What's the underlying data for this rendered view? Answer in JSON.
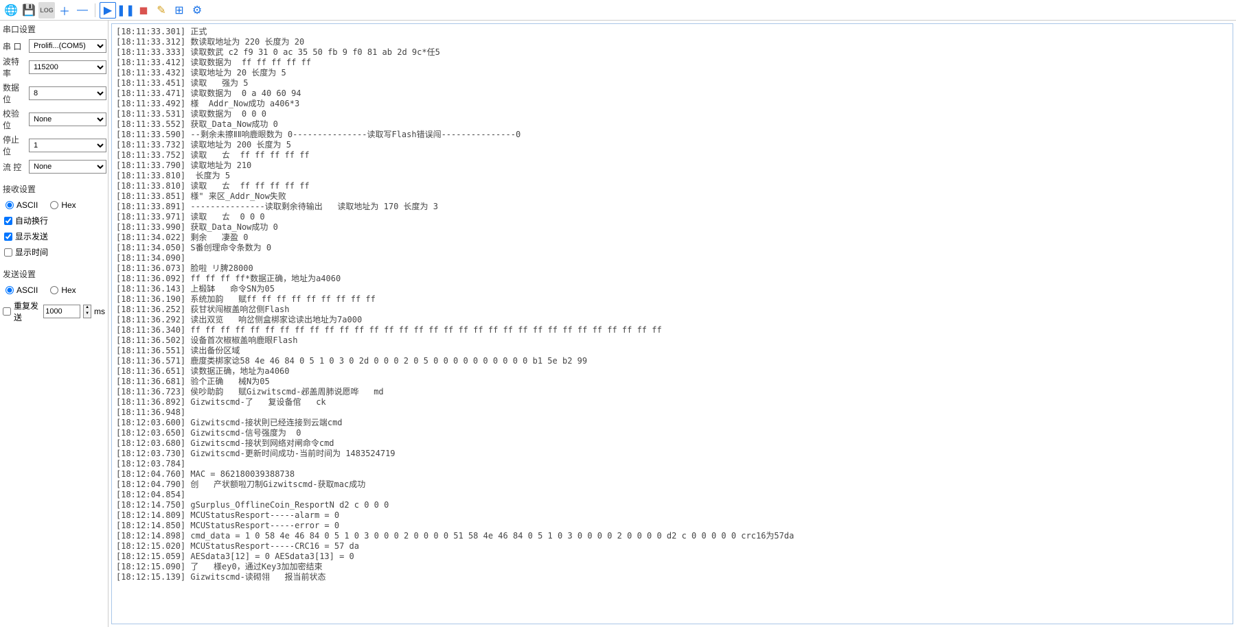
{
  "toolbar": {
    "icons": [
      {
        "name": "globe-icon",
        "glyph": "🌐",
        "color": "#1a73e8"
      },
      {
        "name": "save-icon",
        "glyph": "💾",
        "color": "#4caf50"
      },
      {
        "name": "log-icon",
        "glyph": "LOG",
        "color": "#666",
        "small": true
      },
      {
        "name": "plus-icon",
        "glyph": "＋",
        "color": "#1a73e8"
      },
      {
        "name": "minus-icon",
        "glyph": "—",
        "color": "#1a73e8"
      },
      {
        "name": "sep"
      },
      {
        "name": "play-icon",
        "glyph": "▶",
        "color": "#1a73e8",
        "boxed": true
      },
      {
        "name": "pause-icon",
        "glyph": "❚❚",
        "color": "#1a73e8"
      },
      {
        "name": "stop-icon",
        "glyph": "◼",
        "color": "#d9534f"
      },
      {
        "name": "wand-icon",
        "glyph": "✎",
        "color": "#d4a020"
      },
      {
        "name": "add-panel-icon",
        "glyph": "⊞",
        "color": "#1a73e8"
      },
      {
        "name": "gear-icon",
        "glyph": "⚙",
        "color": "#1a73e8"
      }
    ]
  },
  "port_settings": {
    "header": "串口设置",
    "port": {
      "label": "串  口",
      "value": "Prolifi...(COM5)"
    },
    "baud": {
      "label": "波特率",
      "value": "115200"
    },
    "databits": {
      "label": "数据位",
      "value": "8"
    },
    "parity": {
      "label": "校验位",
      "value": "None"
    },
    "stopbits": {
      "label": "停止位",
      "value": "1"
    },
    "flow": {
      "label": "流  控",
      "value": "None"
    }
  },
  "recv_settings": {
    "header": "接收设置",
    "ascii": "ASCII",
    "hex": "Hex",
    "ascii_selected": true,
    "auto_wrap": {
      "label": "自动换行",
      "checked": true
    },
    "show_send": {
      "label": "显示发送",
      "checked": true
    },
    "show_time": {
      "label": "显示时间",
      "checked": false
    }
  },
  "send_settings": {
    "header": "发送设置",
    "ascii": "ASCII",
    "hex": "Hex",
    "ascii_selected": true,
    "repeat_send": {
      "label": "重复发送",
      "checked": false,
      "value": "1000",
      "unit": "ms"
    }
  },
  "log": [
    "[18:11:33.301] 正式",
    "[18:11:33.312] 数读取地址为 220 长度为 20",
    "[18:11:33.333] 读取数武 c2 f9 31 0 ac 35 50 fb 9 f0 81 ab 2d 9c*任5",
    "[18:11:33.412] 读取数据为  ff ff ff ff ff",
    "[18:11:33.432] 读取地址为 20 长度为 5",
    "[18:11:33.451] 读取   强为 5",
    "[18:11:33.471] 读取数据为  0 a 40 60 94",
    "[18:11:33.492] 様  Addr_Now成功 a406*3",
    "[18:11:33.531] 读取数据为  0 0 0",
    "[18:11:33.552] 获取_Data_Now成功 0",
    "[18:11:33.590] --剩余未擦ⅡⅡ响鹿眼数为 0---------------读取写Flash错误闯---------------0",
    "[18:11:33.732] 读取地址为 200 长度为 5",
    "[18:11:33.752] 读取   ㄊ  ff ff ff ff ff",
    "[18:11:33.790] 读取地址为 210",
    "[18:11:33.810]  长度为 5",
    "[18:11:33.810] 读取   ㄊ  ff ff ff ff ff",
    "[18:11:33.851] 様\" 来区_Addr_Now失败",
    "[18:11:33.891] ---------------读取剩余待输出   读取地址为 170 长度为 3",
    "[18:11:33.971] 读取   ㄊ  0 0 0",
    "[18:11:33.990] 获取_Data_Now成功 0",
    "[18:11:34.022] 剩余   凄盈 0",
    "[18:11:34.050] S番创理命令条数为 0",
    "[18:11:34.090]",
    "[18:11:36.073] 脸啦 リ脾28000",
    "[18:11:36.092] ff ff ff ff*数据正确，地址为a4060",
    "[18:11:36.143] 上椴缽   命令SN为05",
    "[18:11:36.190] 系统加韵   赋ff ff ff ff ff ff ff ff ff",
    "[18:11:36.252] 荻甘状闯椒盖响岔侧Flash",
    "[18:11:36.292] 读出双览   响岔侧盒梆家谂读出地址为7a000",
    "[18:11:36.340] ff ff ff ff ff ff ff ff ff ff ff ff ff ff ff ff ff ff ff ff ff ff ff ff ff ff ff ff ff ff ff ff",
    "[18:11:36.502] 设备首次椒椒盖响鹿眼Flash",
    "[18:11:36.551] 读出备份区域",
    "[18:11:36.571] 鹿度类梆家谂58 4e 46 84 0 5 1 0 3 0 2d 0 0 0 2 0 5 0 0 0 0 0 0 0 0 0 0 b1 5e b2 99",
    "[18:11:36.651] 读数据正确，地址为a4060",
    "[18:11:36.681] 验个正确   械N为05",
    "[18:11:36.723] 侯吵助韵   赋Gizwitscmd-邲盖周肺说愿哗   md",
    "[18:11:36.892] Gizwitscmd-了   复设备倌   ck",
    "[18:11:36.948]",
    "[18:12:03.600] Gizwitscmd-接状則已经连接到云端cmd",
    "[18:12:03.650] Gizwitscmd-信号强度为  0",
    "[18:12:03.680] Gizwitscmd-接状到网络对闸命令cmd",
    "[18:12:03.730] Gizwitscmd-更新时间成功-当前时间为 1483524719",
    "[18:12:03.784]",
    "[18:12:04.760] MAC = 862180039388738",
    "[18:12:04.790] 创   产状额啦刀制Gizwitscmd-获取mac成功",
    "[18:12:04.854]",
    "[18:12:14.750] gSurplus_OfflineCoin_ResportN d2 c 0 0 0",
    "[18:12:14.809] MCUStatusResport-----alarm = 0",
    "[18:12:14.850] MCUStatusResport-----error = 0",
    "[18:12:14.898] cmd_data = 1 0 58 4e 46 84 0 5 1 0 3 0 0 0 2 0 0 0 0 51 58 4e 46 84 0 5 1 0 3 0 0 0 0 2 0 0 0 0 d2 c 0 0 0 0 0 crc16为57da",
    "[18:12:15.020] MCUStatusResport-----CRC16 = 57 da",
    "[18:12:15.059] AESdata3[12] = 0 AESdata3[13] = 0",
    "[18:12:15.090] 了   様ey0，通过Key3加加密结束",
    "[18:12:15.139] Gizwitscmd-读砌翎   报当前状态"
  ]
}
